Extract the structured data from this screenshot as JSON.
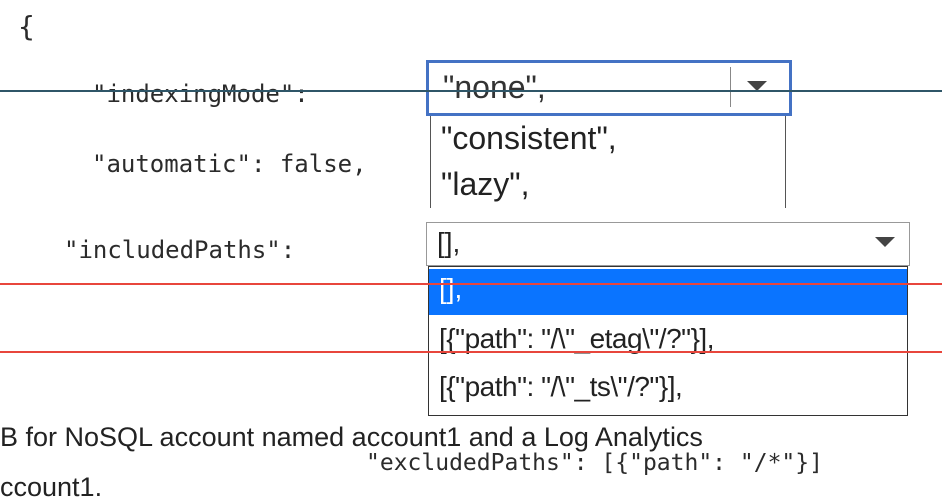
{
  "code": {
    "brace": "{",
    "indexing_key": "\"indexingMode\":",
    "automatic_line": "\"automatic\": false,",
    "included_key": "\"includedPaths\":",
    "excluded_line": "\"excludedPaths\": [{\"path\": \"/*\"}]"
  },
  "indexing_mode": {
    "selected": "\"none\",",
    "options": [
      "\"consistent\",",
      "\"lazy\","
    ]
  },
  "included_paths": {
    "selected": "[],",
    "options": [
      "[],",
      "[{\"path\": \"/\\\"_etag\\\"/?\"}],",
      "[{\"path\": \"/\\\"_ts\\\"/?\"}],"
    ]
  },
  "background_text": {
    "line1": "B for NoSQL account named account1 and a Log Analytics",
    "line2": "ccount1."
  },
  "colors": {
    "focus_border": "#4472c4",
    "highlight": "#0a74ff",
    "overlay_dark_line": "#2f5668",
    "overlay_red_line": "#e8463c"
  }
}
